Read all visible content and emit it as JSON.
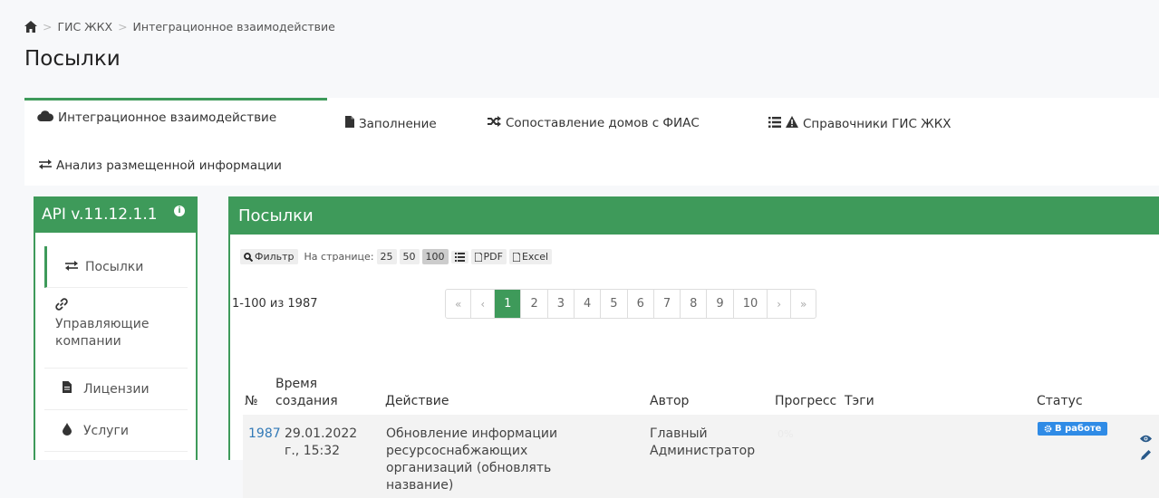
{
  "breadcrumb": {
    "items": [
      "ГИС ЖКХ",
      "Интеграционное взаимодействие"
    ]
  },
  "page": {
    "title": "Посылки"
  },
  "tabs": [
    {
      "label": "Интеграционное взаимодействие",
      "icon": "cloud-icon",
      "active": true
    },
    {
      "label": "Заполнение",
      "icon": "file-icon",
      "active": false
    },
    {
      "label": "Сопоставление домов с ФИАС",
      "icon": "shuffle-icon",
      "active": false
    },
    {
      "label": "Справочники ГИС ЖКХ",
      "icon": "list-warning-icon",
      "active": false
    },
    {
      "label": "Анализ размещенной информации",
      "icon": "exchange-icon",
      "active": false
    }
  ],
  "sidebar": {
    "title": "API v.11.12.1.1",
    "items": [
      {
        "label": "Посылки",
        "icon": "exchange-icon",
        "active": true
      },
      {
        "label": "Управляющие компании",
        "icon": "link-icon"
      },
      {
        "label": "Лицензии",
        "icon": "file-icon"
      },
      {
        "label": "Услуги",
        "icon": "drop-icon"
      }
    ]
  },
  "main": {
    "title": "Посылки",
    "toolbar": {
      "filter": "Фильтр",
      "per_page_label": "На странице:",
      "per_page_options": [
        "25",
        "50",
        "100"
      ],
      "per_page_selected": "100",
      "pdf": "PDF",
      "excel": "Excel"
    },
    "count_text": "1-100 из 1987",
    "pagination": {
      "first": "«",
      "prev": "‹",
      "pages": [
        "1",
        "2",
        "3",
        "4",
        "5",
        "6",
        "7",
        "8",
        "9",
        "10"
      ],
      "current": "1",
      "next": "›",
      "last": "»"
    },
    "table": {
      "headers": {
        "num": "№",
        "time": "Время создания",
        "action": "Действие",
        "author": "Автор",
        "progress": "Прогресс",
        "tags": "Тэги",
        "status": "Статус"
      },
      "rows": [
        {
          "num": "1987",
          "time": "29.01.2022 г., 15:32",
          "action": "Обновление информации ресурсоснабжающих организаций (обновлять название)",
          "author": "Главный Администратор",
          "progress": "0%",
          "status": "В работе"
        }
      ]
    }
  },
  "colors": {
    "accent": "#3e9a5a",
    "status_blue": "#2f8be6",
    "link": "#337ab7"
  }
}
